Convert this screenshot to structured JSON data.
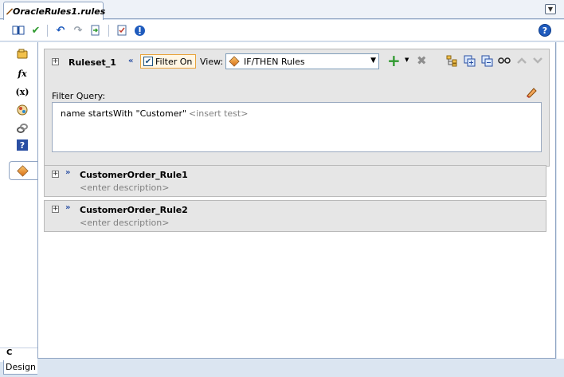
{
  "editor_tab": {
    "title": "OracleRules1.rules",
    "icon": "rules-file-icon"
  },
  "toolbar": {
    "icons": [
      "dictionary-icon",
      "validate-check-icon",
      "undo-icon",
      "redo-icon",
      "export-icon",
      "test-checklist-icon",
      "info-icon"
    ],
    "help_label": "?"
  },
  "sidebar": {
    "items": [
      {
        "name": "facts-icon",
        "glyph": ""
      },
      {
        "name": "functions-icon",
        "glyph": "fx"
      },
      {
        "name": "globals-icon",
        "glyph": "(x)"
      },
      {
        "name": "bucketsets-icon",
        "glyph": ""
      },
      {
        "name": "links-icon",
        "glyph": ""
      },
      {
        "name": "decision-functions-icon",
        "glyph": "?"
      },
      {
        "name": "rulesets-icon",
        "glyph": ""
      }
    ],
    "bottom_label": "C",
    "design_tab": "Design"
  },
  "ruleset": {
    "expander": "+",
    "name": "Ruleset_1",
    "filter_on_label": "Filter On",
    "filter_on_checked": true,
    "view_label": "View:",
    "view_selected": "IF/THEN Rules",
    "right_icons": [
      "tree-view-icon",
      "expand-all-icon",
      "collapse-all-icon",
      "show-advanced-icon",
      "move-up-icon",
      "move-down-icon"
    ],
    "filter_query_label": "Filter Query:",
    "filter_query_text": "name startsWith \"Customer\"",
    "filter_insert_placeholder": "<insert test>"
  },
  "rules": [
    {
      "expander": "+",
      "name": "CustomerOrder_Rule1",
      "description": "<enter description>"
    },
    {
      "expander": "+",
      "name": "CustomerOrder_Rule2",
      "description": "<enter description>"
    }
  ],
  "colors": {
    "accent_blue": "#2a4fa3",
    "add_green": "#2f9a2f",
    "panel_gray": "#e6e6e6",
    "filter_highlight": "#e8a33b"
  }
}
